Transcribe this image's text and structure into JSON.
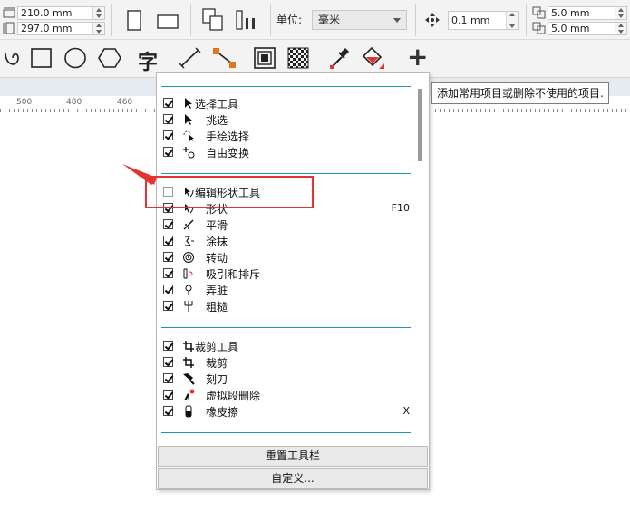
{
  "toolbar1": {
    "width_value": "210.0 mm",
    "height_value": "297.0 mm",
    "units_label": "单位:",
    "units_value": "毫米",
    "nudge_value": "0.1 mm",
    "dup_x_value": "5.0 mm",
    "dup_y_value": "5.0 mm"
  },
  "toolbar2": {
    "text_tool_glyph": "字",
    "add_glyph": "+"
  },
  "ruler": {
    "ticks": [
      "500",
      "480",
      "460"
    ]
  },
  "tooltip": "添加常用项目或删除不使用的项目.",
  "menu": {
    "groups": [
      {
        "items": [
          {
            "label": "选择工具",
            "checked": true,
            "icon": "pick-arrow-icon",
            "header": true
          },
          {
            "label": "挑选",
            "checked": true,
            "icon": "pick-arrow-icon"
          },
          {
            "label": "手绘选择",
            "checked": true,
            "icon": "freehand-pick-icon"
          },
          {
            "label": "自由变换",
            "checked": true,
            "icon": "free-transform-icon"
          }
        ]
      },
      {
        "items": [
          {
            "label": "编辑形状工具",
            "checked": false,
            "icon": "shape-edit-icon",
            "header": true
          },
          {
            "label": "形状",
            "checked": true,
            "icon": "shape-icon",
            "shortcut": "F10"
          },
          {
            "label": "平滑",
            "checked": true,
            "icon": "smooth-icon"
          },
          {
            "label": "涂抹",
            "checked": true,
            "icon": "smear-icon"
          },
          {
            "label": "转动",
            "checked": true,
            "icon": "twirl-icon"
          },
          {
            "label": "吸引和排斥",
            "checked": true,
            "icon": "attract-repel-icon"
          },
          {
            "label": "弄脏",
            "checked": true,
            "icon": "smudge-icon"
          },
          {
            "label": "粗糙",
            "checked": true,
            "icon": "roughen-icon"
          }
        ]
      },
      {
        "items": [
          {
            "label": "裁剪工具",
            "checked": true,
            "icon": "crop-icon",
            "header": true
          },
          {
            "label": "裁剪",
            "checked": true,
            "icon": "crop-icon"
          },
          {
            "label": "刻刀",
            "checked": true,
            "icon": "knife-icon"
          },
          {
            "label": "虚拟段删除",
            "checked": true,
            "icon": "virtual-segment-delete-icon"
          },
          {
            "label": "橡皮擦",
            "checked": true,
            "icon": "eraser-icon",
            "shortcut": "X"
          }
        ]
      }
    ],
    "reset_button": "重置工具栏",
    "customize_button": "自定义..."
  },
  "colors": {
    "accent_rule": "#1a9ab8",
    "highlight": "#e5342f"
  }
}
